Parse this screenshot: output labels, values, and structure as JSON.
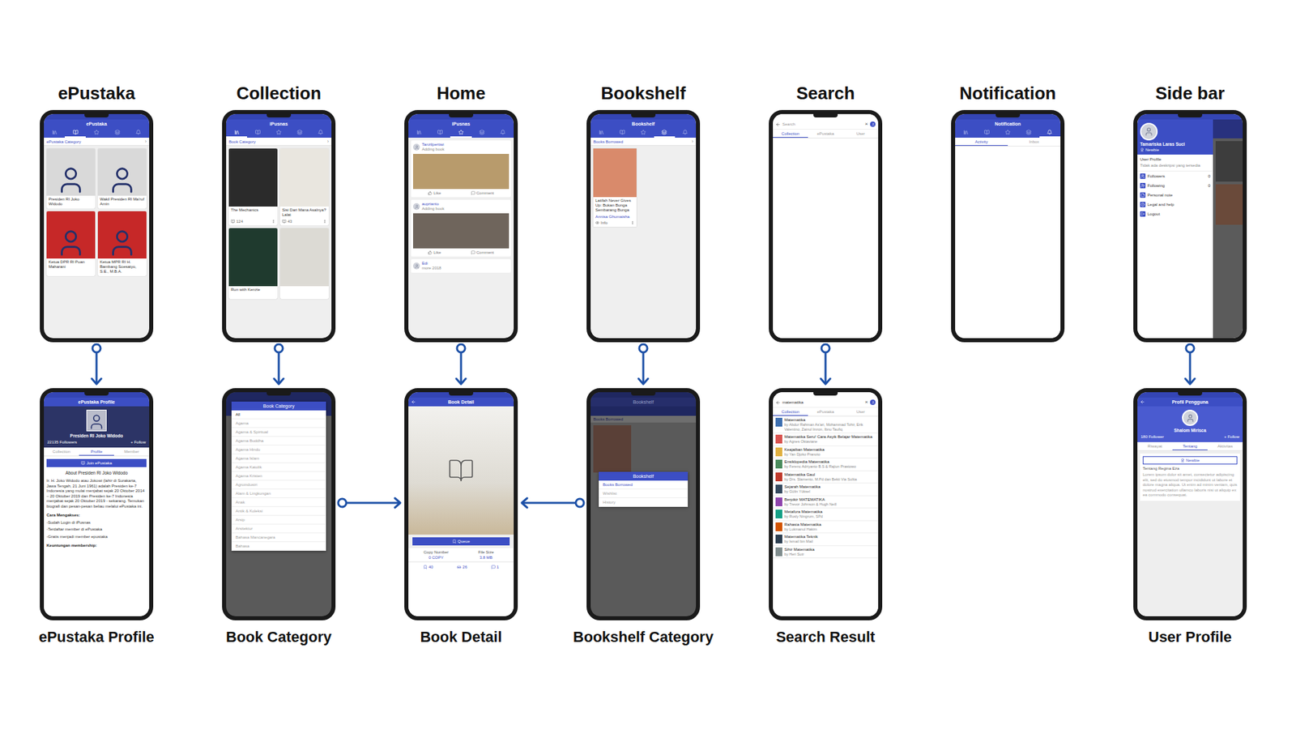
{
  "columns": [
    {
      "label": "ePustaka",
      "screen": {
        "kind": "cards",
        "title": "ePustaka",
        "nav": [
          {
            "selected": false
          },
          {
            "selected": true
          },
          {
            "selected": false
          },
          {
            "selected": false
          },
          {
            "selected": false
          }
        ],
        "section": "ePustaka Category",
        "chevron": "›",
        "cards": [
          {
            "name": "Presiden RI Joko Widodo"
          },
          {
            "name": "Wakil Presiden RI Ma'ruf Amin"
          },
          {
            "name": "Ketua DPR RI Puan Maharani"
          },
          {
            "name": "Ketua MPR RI H. Bambang Soesatyo, S.E., M.B.A."
          }
        ]
      },
      "detail": {
        "label": "ePustaka Profile",
        "screen": {
          "kind": "org-profile",
          "title": "ePustaka Profile",
          "name": "Presiden RI Joko Widodo",
          "followers": "22135 Followers",
          "follow": "+ Follow",
          "tabs": [
            {
              "label": "Collection",
              "selected": false
            },
            {
              "label": "Profile",
              "selected": true
            },
            {
              "label": "Member",
              "selected": false
            }
          ],
          "button": "Join ePustaka",
          "about_title": "About Presiden RI Joko Widodo",
          "about": "Ir. H. Joko Widodo atau Jokowi (lahir di Surakarta, Jawa Tengah, 21 Juni 1961) adalah Presiden ke-7 Indonesia yang mulai menjabat sejak 20 Oktober 2014 – 20 Oktober 2019 dan Presiden ke-7 Indonesia menjabat sejak 20 Oktober 2019 - sekarang. Temukan biografi dan pesan-pesan beliau melalui ePustaka ini.",
          "steps_title": "Cara Mengakses:",
          "steps": [
            "-Sudah Login di iPusnas",
            "-Terdaftar member di ePustaka",
            "-Gratis menjadi member epustaka"
          ],
          "footer": "Keuntungan membership:"
        }
      }
    },
    {
      "label": "Collection",
      "screen": {
        "kind": "books",
        "title": "iPusnas",
        "nav": [
          {
            "selected": true
          },
          {
            "selected": false
          },
          {
            "selected": false
          },
          {
            "selected": false
          },
          {
            "selected": false
          }
        ],
        "section": "Book Category",
        "chevron": "›",
        "books": [
          {
            "title": "The Mechanics",
            "count": "124",
            "color": "#2b2b2b"
          },
          {
            "title": "Sisi Dari Mana Asalnya? Lalat",
            "count": "43",
            "color": "#e9e6df"
          },
          {
            "title": "Run with Kenzie",
            "color": "#1f3a2e"
          },
          {
            "color": "#dcdad4"
          }
        ]
      },
      "detail": {
        "label": "Book Category",
        "screen": {
          "kind": "category",
          "title": "Book Category",
          "items": [
            {
              "label": "All",
              "selected": true
            },
            {
              "label": "Agama",
              "selected": false
            },
            {
              "label": "Agama & Spiritual",
              "selected": false
            },
            {
              "label": "Agama Buddha",
              "selected": false
            },
            {
              "label": "Agama Hindu",
              "selected": false
            },
            {
              "label": "Agama Islam",
              "selected": false
            },
            {
              "label": "Agama Katolik",
              "selected": false
            },
            {
              "label": "Agama Kristen",
              "selected": false
            },
            {
              "label": "Agroindustri",
              "selected": false
            },
            {
              "label": "Alam & Lingkungan",
              "selected": false
            },
            {
              "label": "Anak",
              "selected": false
            },
            {
              "label": "Antik & Koleksi",
              "selected": false
            },
            {
              "label": "Arsip",
              "selected": false
            },
            {
              "label": "Arsitektur",
              "selected": false
            },
            {
              "label": "Bahasa Mancanegara",
              "selected": false
            },
            {
              "label": "Bahasa",
              "selected": false
            }
          ]
        }
      }
    },
    {
      "label": "Home",
      "screen": {
        "kind": "feed",
        "title": "iPusnas",
        "nav": [
          {
            "selected": false
          },
          {
            "selected": false
          },
          {
            "selected": true
          },
          {
            "selected": false
          },
          {
            "selected": false
          }
        ],
        "posts": [
          {
            "user": "Tanzilpertiwi",
            "action": "Adding book",
            "color": "#b89b6c",
            "like": "Like",
            "comment": "Comment"
          },
          {
            "user": "auprianto",
            "action": "Adding book",
            "color": "#6f655c",
            "like": "Like",
            "comment": "Comment"
          },
          {
            "user": "Edi",
            "action": "more 2018"
          }
        ]
      },
      "detail": {
        "label": "Book Detail",
        "screen": {
          "kind": "book-detail",
          "title": "Book Detail",
          "button": "Queue",
          "info": [
            {
              "label": "Copy Number",
              "value": "0 COPY"
            },
            {
              "label": "File Size",
              "value": "3.8 MB"
            }
          ],
          "stats": [
            "40",
            "26",
            "1"
          ]
        }
      }
    },
    {
      "label": "Bookshelf",
      "screen": {
        "kind": "shelf",
        "title": "Bookshelf",
        "nav": [
          {
            "selected": false
          },
          {
            "selected": false
          },
          {
            "selected": false
          },
          {
            "selected": true
          },
          {
            "selected": false
          }
        ],
        "section": "Books Borrowed",
        "chevron": "›",
        "book": {
          "title": "Latifah Never Gives Up: Bukan Bunga Sembarang Bunga",
          "author": "Annisa Ghumaisha",
          "info": "Info",
          "color": "#d98a6b"
        }
      },
      "detail": {
        "label": "Bookshelf Category",
        "screen": {
          "kind": "shelf-dialog",
          "title": "Bookshelf",
          "section": "Books Borrowed",
          "dialog": "Bookshelf",
          "options": [
            {
              "label": "Books Borrowed",
              "selected": true
            },
            {
              "label": "Wishlist",
              "selected": false
            },
            {
              "label": "History",
              "selected": false
            }
          ]
        }
      }
    },
    {
      "label": "Search",
      "screen": {
        "kind": "search",
        "placeholder": "Search",
        "close": "×",
        "tabs": [
          {
            "label": "Collection",
            "selected": true
          },
          {
            "label": "ePustaka",
            "selected": false
          },
          {
            "label": "User",
            "selected": false
          }
        ]
      },
      "detail": {
        "label": "Search Result",
        "screen": {
          "kind": "search-result",
          "query": "matematika",
          "close": "×",
          "tabs": [
            {
              "label": "Collection",
              "selected": true
            },
            {
              "label": "ePustaka",
              "selected": false
            },
            {
              "label": "User",
              "selected": false
            }
          ],
          "results": [
            {
              "title": "Matematika",
              "author": "by Abdur Rahman As'ari, Mohammad Tohir, Erik Valentino, Zainul Imron, Ibnu Taufiq",
              "color": "#3d6fb0"
            },
            {
              "title": "Matematika Seru! Cara Asyik Belajar Matematika",
              "author": "by Agnes Oktaviane",
              "color": "#d9534f"
            },
            {
              "title": "Keajaiban Matematika",
              "author": "by Yan Djoko Pranoto",
              "color": "#e0b040"
            },
            {
              "title": "Ensiklopedia Matematika",
              "author": "by Ferenc Adriyanto B.S & Rajiun Prastowo",
              "color": "#4a8b5c"
            },
            {
              "title": "Matematika Gaul",
              "author": "by Drs. Slamento, M.Pd dan Bekti Via Sulita",
              "color": "#c0392b"
            },
            {
              "title": "Sejarah Matematika",
              "author": "by Gülin Yüksel",
              "color": "#34495e"
            },
            {
              "title": "Berpikir MATEMATIKA",
              "author": "by Trevor Johnson & Hugh Neill",
              "color": "#8e44ad"
            },
            {
              "title": "Metafora Matematika",
              "author": "by Rusly Ningrum, SPd",
              "color": "#16a085"
            },
            {
              "title": "Rahasia Matematika",
              "author": "by Lukmanul Hakim",
              "color": "#d35400"
            },
            {
              "title": "Matematika Teknik",
              "author": "by Ismail bin Mail",
              "color": "#2c3e50"
            },
            {
              "title": "Sihir Matematika",
              "author": "by Heri Sutr",
              "color": "#7f8c8d"
            }
          ]
        }
      }
    },
    {
      "label": "Notification",
      "screen": {
        "kind": "notification",
        "title": "Notification",
        "nav": [
          {
            "selected": false
          },
          {
            "selected": false
          },
          {
            "selected": false
          },
          {
            "selected": false
          },
          {
            "selected": true
          }
        ],
        "tabs": [
          {
            "label": "Activity",
            "selected": true
          },
          {
            "label": "Inbox",
            "selected": false
          }
        ]
      },
      "detail": null
    },
    {
      "label": "Side bar",
      "screen": {
        "kind": "drawer",
        "name": "Tamariska Laras Suci",
        "badge": "Newbie",
        "profile": "User Profile",
        "desc": "Tidak ada deskripsi yang tersedia",
        "items": [
          {
            "label": "Followers",
            "count": "0"
          },
          {
            "label": "Following",
            "count": "0"
          },
          {
            "label": "Personal note"
          },
          {
            "label": "Legal and help"
          },
          {
            "label": "Logout"
          }
        ]
      },
      "detail": {
        "label": "User Profile",
        "screen": {
          "kind": "user-profile",
          "title": "Profil Pengguna",
          "name": "Shalom Mirisca",
          "followers": "180 Follower",
          "follow": "+ Follow",
          "tabs": [
            {
              "label": "Riwayat",
              "selected": false
            },
            {
              "label": "Tentang",
              "selected": true
            },
            {
              "label": "Aktivitas",
              "selected": false
            }
          ],
          "badge": "Newbie",
          "about_title": "Tentang Regina Eza",
          "about": "Lorem ipsum dolor sit amet, consectetur adipiscing elit, sed do eiusmod tempor incididunt ut labore et dolore magna aliqua. Ut enim ad minim veniam, quis nostrud exercitation ullamco laboris nisi ut aliquip ex ea commodo consequat."
        }
      }
    }
  ],
  "edges": [
    {
      "from": "Book Category",
      "to": "Book Detail"
    },
    {
      "from": "Bookshelf Category",
      "to": "Book Detail"
    }
  ]
}
